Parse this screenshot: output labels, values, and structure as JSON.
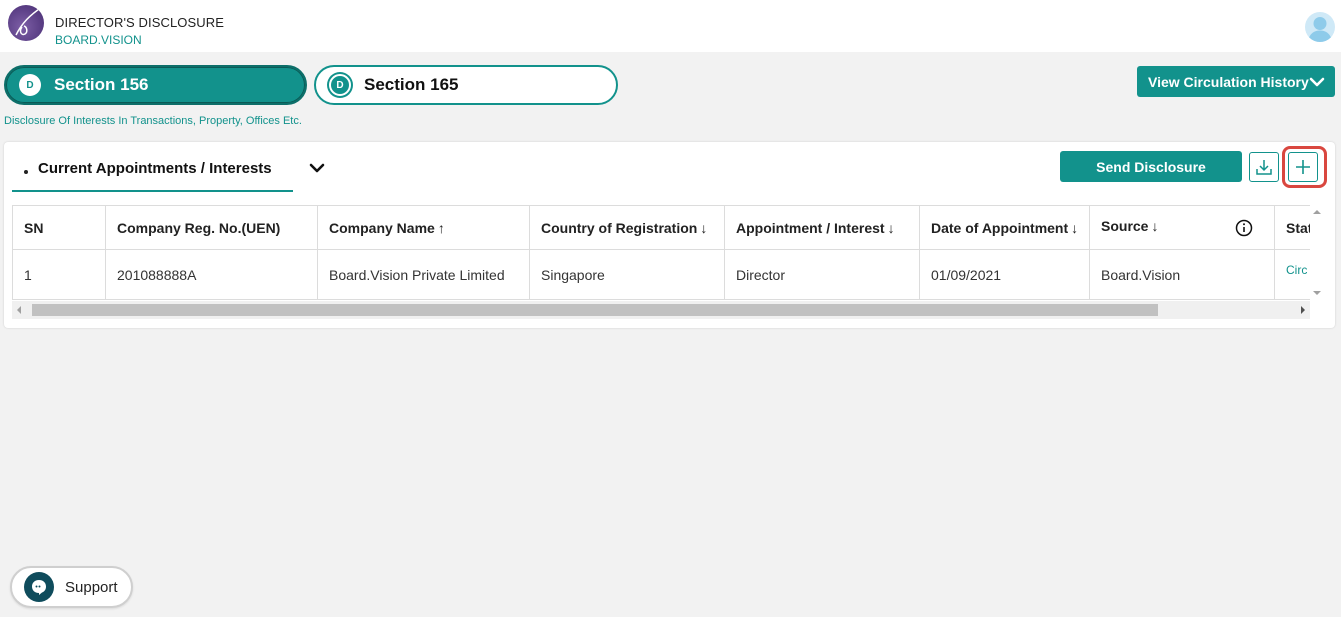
{
  "header": {
    "title": "DIRECTOR'S DISCLOSURE",
    "subtitle": "BOARD.VISION"
  },
  "sections": [
    {
      "badge": "D",
      "label": "Section 156",
      "active": true
    },
    {
      "badge": "D",
      "label": "Section 165",
      "active": false
    }
  ],
  "section_description": "Disclosure Of Interests In Transactions, Property, Offices Etc.",
  "circulation_button": "View Circulation History",
  "card": {
    "tab_label": "Current Appointments / Interests",
    "send_button": "Send Disclosure"
  },
  "table": {
    "columns": [
      {
        "label": "SN",
        "sort": ""
      },
      {
        "label": "Company Reg. No.(UEN)",
        "sort": ""
      },
      {
        "label": "Company Name",
        "sort": "↑"
      },
      {
        "label": "Country of Registration",
        "sort": "↓"
      },
      {
        "label": "Appointment / Interest",
        "sort": "↓"
      },
      {
        "label": "Date of Appointment",
        "sort": "↓"
      },
      {
        "label": "Source",
        "sort": "↓"
      },
      {
        "label": "Stat",
        "sort": ""
      }
    ],
    "rows": [
      [
        "1",
        "201088888A",
        "Board.Vision Private Limited",
        "Singapore",
        "Director",
        "01/09/2021",
        "Board.Vision",
        "Circ"
      ]
    ]
  },
  "support_label": "Support",
  "colors": {
    "accent": "#12928c",
    "highlight": "#d9473f"
  },
  "icons": {
    "logo": "board-vision-logo",
    "avatar": "user-avatar-icon",
    "chevron": "chevron-down-icon",
    "download": "download-icon",
    "add": "plus-icon",
    "info": "info-icon",
    "support": "chat-icon"
  }
}
